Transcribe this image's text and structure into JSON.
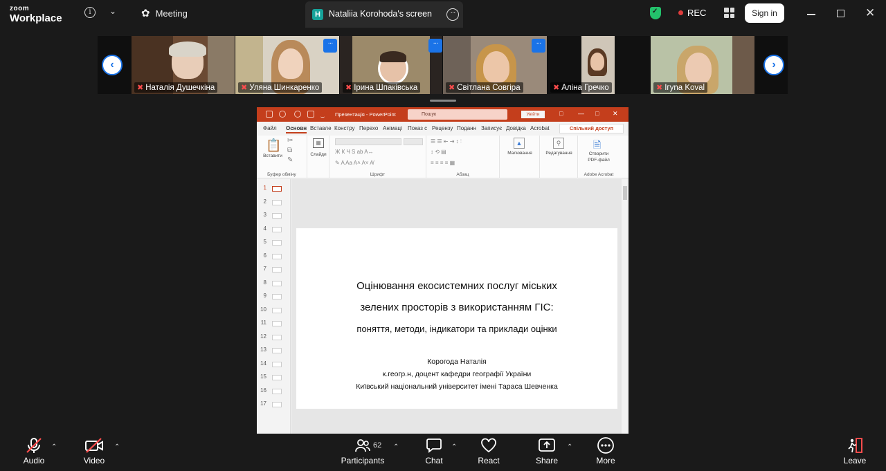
{
  "app": {
    "logo_line1": "zoom",
    "logo_line2": "Workplace"
  },
  "topbar": {
    "meeting_label": "Meeting",
    "screen_tab_label": "Nataliia Korohoda's screen",
    "screen_tab_badge": "H",
    "rec_label": "REC",
    "sign_in_label": "Sign in"
  },
  "participants_strip": [
    {
      "name": "Наталія Душечкіна"
    },
    {
      "name": "Уляна Шинкаренко"
    },
    {
      "name": "Ірина Шпаківська"
    },
    {
      "name": "Світлана Совгіра"
    },
    {
      "name": "Аліна Гречко"
    },
    {
      "name": "Ігуna Koval"
    }
  ],
  "powerpoint": {
    "doc_title": "Презентація  -  PowerPoint",
    "search_placeholder": "Пошук",
    "sign_in": "Увійти",
    "share": "Спільний доступ",
    "tabs": [
      "Файл",
      "Основн",
      "Вставле",
      "Констру",
      "Перехо",
      "Анімаці",
      "Показ с",
      "Рецензу",
      "Поданн",
      "Записує",
      "Довідка",
      "Acrobat"
    ],
    "ribbon": {
      "paste": "Вставити",
      "clipboard_caption": "Буфер обміну",
      "slides": "Слайди",
      "font_caption": "Шрифт",
      "paragraph_caption": "Абзац",
      "drawing": "Малювання",
      "editing": "Редагування",
      "create_pdf_line1": "Створити",
      "create_pdf_line2": "PDF-файл",
      "acrobat_caption": "Adobe Acrobat"
    },
    "thumbnails": [
      "1",
      "2",
      "3",
      "4",
      "5",
      "6",
      "7",
      "8",
      "9",
      "10",
      "11",
      "12",
      "13",
      "14",
      "15",
      "16",
      "17"
    ],
    "slide": {
      "title_line1": "Оцінювання екосистемних послуг міських",
      "title_line2": "зелених просторів з використанням ГІС:",
      "title_line3": "поняття, методи, індикатори та приклади оцінки",
      "author": "Корогода Наталія",
      "position": "к.геогр.н, доцент кафедри географії України",
      "university": "Київський національний університет імені Тараса Шевченка"
    }
  },
  "toolbar": {
    "audio": "Audio",
    "video": "Video",
    "participants": "Participants",
    "participants_count": "62",
    "chat": "Chat",
    "react": "React",
    "share": "Share",
    "more": "More",
    "leave": "Leave"
  },
  "colors": {
    "ppt_accent": "#c43e1c",
    "zoom_blue": "#1a73e8",
    "mute_red": "#ff4d4d",
    "shield_green": "#23c16b"
  }
}
